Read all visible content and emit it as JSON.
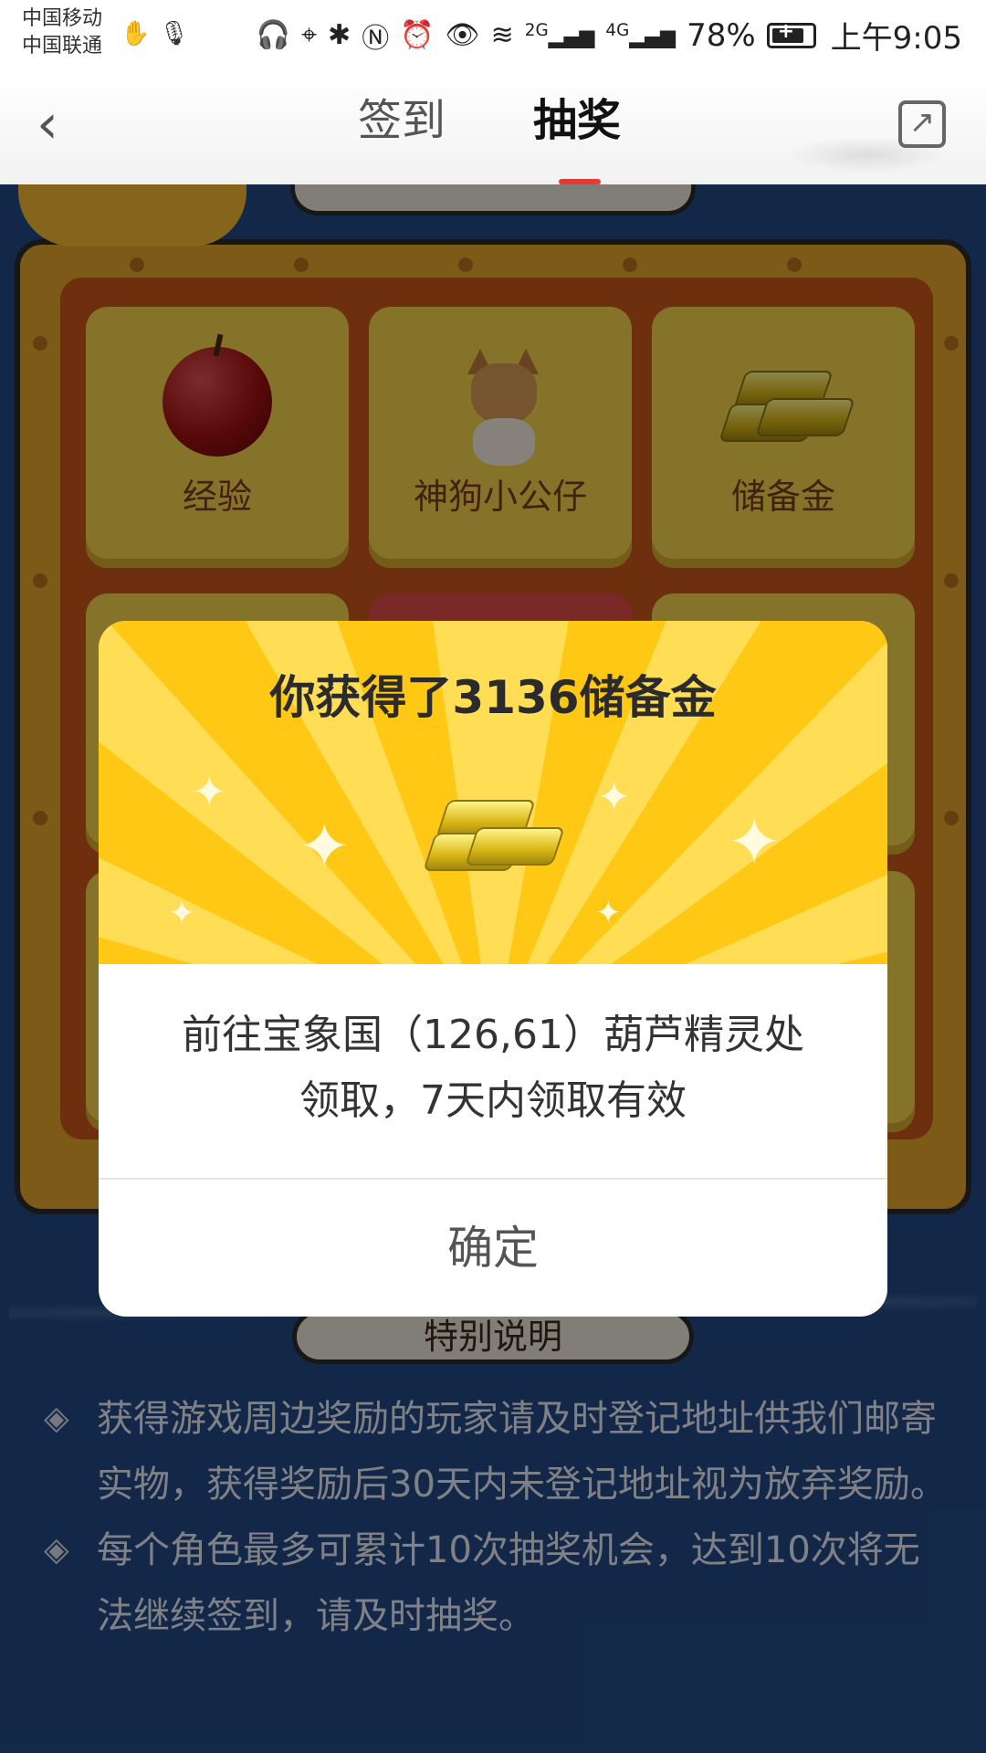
{
  "status_bar": {
    "carrier_1": "中国移动",
    "carrier_2": "中国联通",
    "network_1": "2G",
    "network_2": "4G",
    "battery": "78%",
    "time": "上午9:05"
  },
  "header": {
    "tab_sign": "签到",
    "tab_lottery": "抽奖",
    "active_tab": "抽奖"
  },
  "board": {
    "prizes": [
      {
        "label": "经验",
        "icon": "apple-icon"
      },
      {
        "label": "神狗小公仔",
        "icon": "dog-figure-icon"
      },
      {
        "label": "储备金",
        "icon": "gold-bar-icon"
      }
    ]
  },
  "special": {
    "title": "特别说明",
    "notes": [
      "获得游戏周边奖励的玩家请及时登记地址供我们邮寄实物，获得奖励后30天内未登记地址视为放弃奖励。",
      "每个角色最多可累计10次抽奖机会，达到10次将无法继续签到，请及时抽奖。"
    ]
  },
  "modal": {
    "title": "你获得了3136储备金",
    "message_line1": "前往宝象国（126,61）葫芦精灵处",
    "message_line2": "领取，7天内领取有效",
    "confirm_label": "确定"
  },
  "colors": {
    "background_blue": "#234a86",
    "modal_yellow": "#ffc815",
    "board_orange": "#c9561c",
    "tab_underline_red": "#e53935"
  }
}
